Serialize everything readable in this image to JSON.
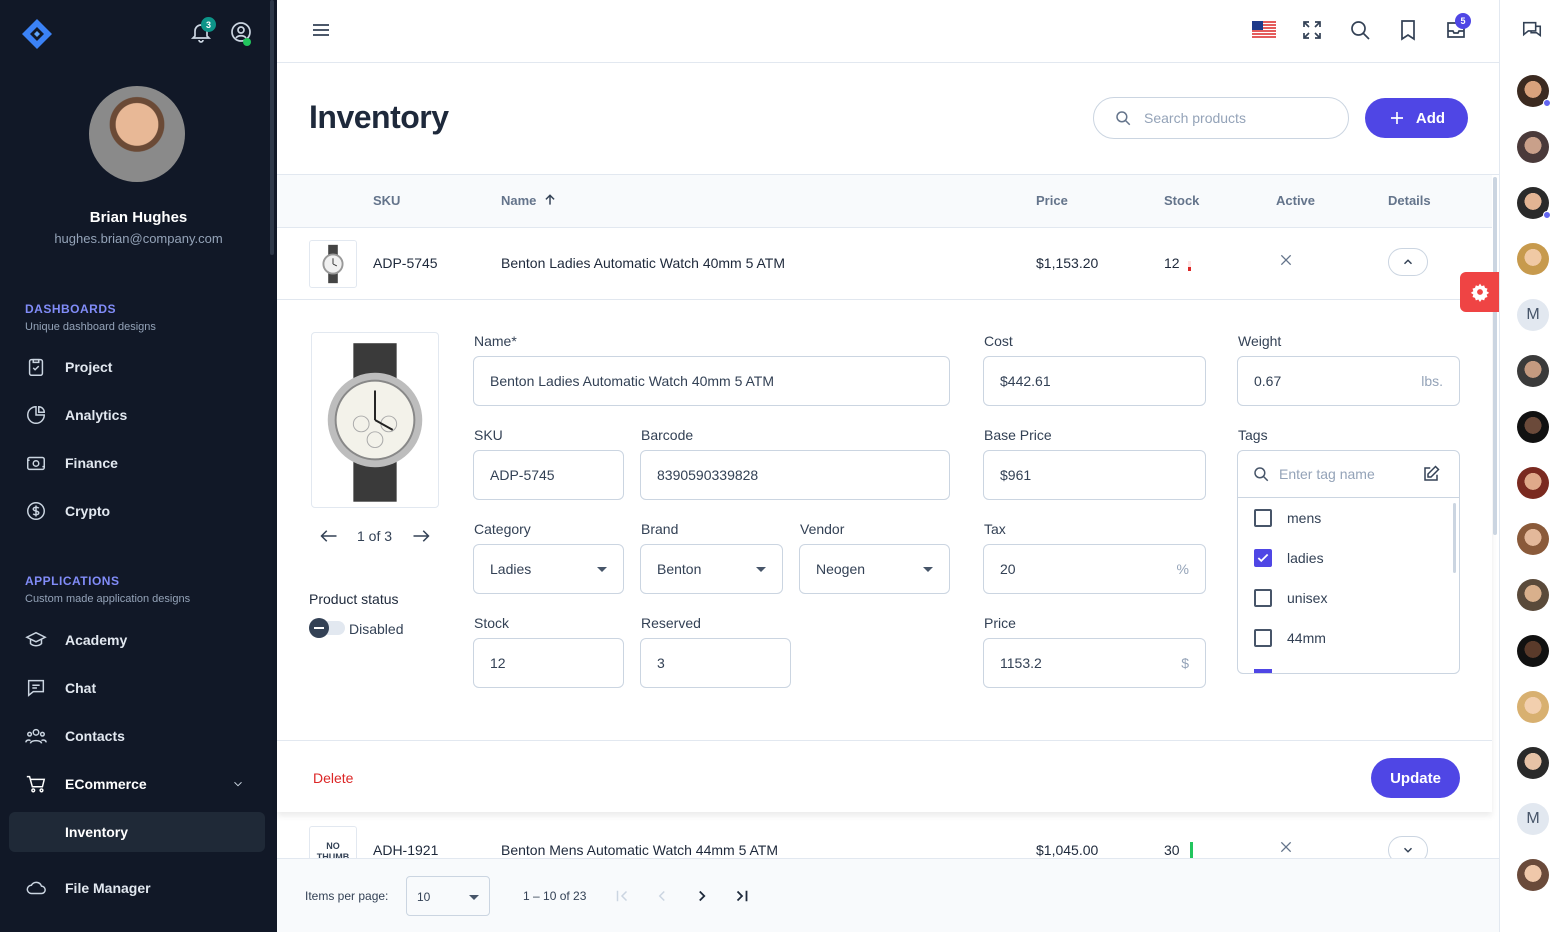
{
  "sidebar": {
    "notifications_count": "3",
    "user": {
      "name": "Brian Hughes",
      "email": "hughes.brian@company.com"
    },
    "sections": [
      {
        "title": "DASHBOARDS",
        "subtitle": "Unique dashboard designs"
      },
      {
        "title": "APPLICATIONS",
        "subtitle": "Custom made application designs"
      }
    ],
    "dashboards": [
      "Project",
      "Analytics",
      "Finance",
      "Crypto"
    ],
    "applications": [
      "Academy",
      "Chat",
      "Contacts",
      "ECommerce"
    ],
    "ecommerce_child": "Inventory",
    "file_manager": "File Manager"
  },
  "topbar": {
    "messages_count": "5"
  },
  "header": {
    "title": "Inventory",
    "search_placeholder": "Search products",
    "add_label": "Add"
  },
  "table": {
    "columns": [
      "SKU",
      "Name",
      "Price",
      "Stock",
      "Active",
      "Details"
    ],
    "rows": [
      {
        "sku": "ADP-5745",
        "name": "Benton Ladies Automatic Watch 40mm 5 ATM",
        "price": "$1,153.20",
        "stock": "12"
      },
      {
        "sku": "ADH-1921",
        "name": "Benton Mens Automatic Watch 44mm 5 ATM",
        "price": "$1,045.00",
        "stock": "30",
        "thumb": "NO THUMB"
      }
    ]
  },
  "detail": {
    "image_counter": "1 of 3",
    "status_label": "Product status",
    "status_value": "Disabled",
    "labels": {
      "name": "Name*",
      "sku": "SKU",
      "barcode": "Barcode",
      "category": "Category",
      "brand": "Brand",
      "vendor": "Vendor",
      "stock": "Stock",
      "reserved": "Reserved",
      "cost": "Cost",
      "base_price": "Base Price",
      "tax": "Tax",
      "price": "Price",
      "weight": "Weight",
      "tags": "Tags"
    },
    "values": {
      "name": "Benton Ladies Automatic Watch 40mm 5 ATM",
      "sku": "ADP-5745",
      "barcode": "8390590339828",
      "category": "Ladies",
      "brand": "Benton",
      "vendor": "Neogen",
      "stock": "12",
      "reserved": "3",
      "cost": "$442.61",
      "base_price": "$961",
      "tax": "20",
      "price": "1153.2",
      "weight": "0.67"
    },
    "suffixes": {
      "weight": "lbs.",
      "tax": "%",
      "price": "$"
    },
    "tag_placeholder": "Enter tag name",
    "tags": [
      {
        "label": "mens",
        "checked": false
      },
      {
        "label": "ladies",
        "checked": true
      },
      {
        "label": "unisex",
        "checked": false
      },
      {
        "label": "44mm",
        "checked": false
      }
    ],
    "delete_label": "Delete",
    "update_label": "Update"
  },
  "pager": {
    "items_label": "Items per page:",
    "per_page": "10",
    "range": "1 – 10 of 23"
  },
  "rightbar": {
    "initials": "M"
  },
  "colors": {
    "accent": "#4f46e5",
    "sidebar": "#111827",
    "danger": "#dc2626"
  }
}
